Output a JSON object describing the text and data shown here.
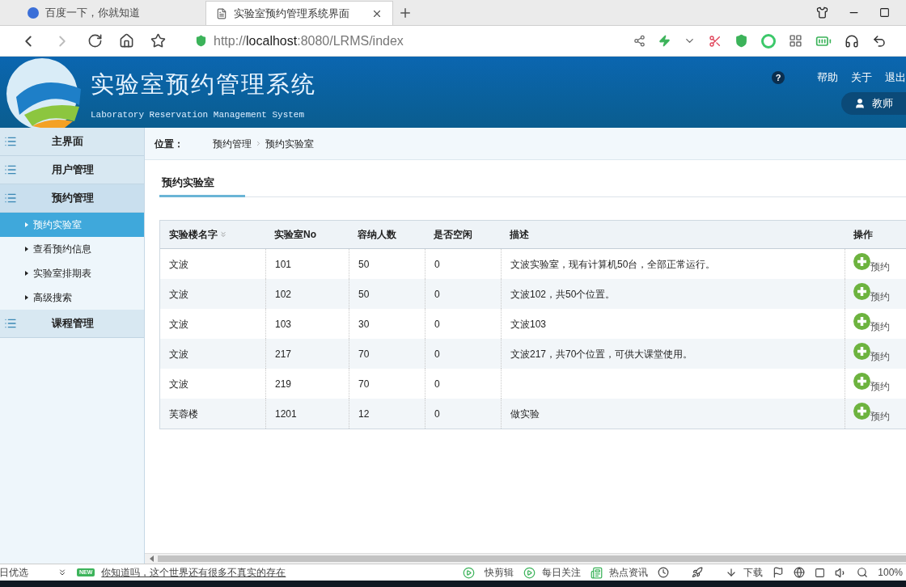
{
  "browser": {
    "tabs": [
      {
        "title": "百度一下，你就知道",
        "selected": false
      },
      {
        "title": "实验室预约管理系统界面",
        "selected": true
      }
    ],
    "url": "http://**localhost**:8080/LRMS/index"
  },
  "header": {
    "title": "实验室预约管理系统",
    "subtitle": "Laboratory Reservation Management System",
    "help_mark": "?",
    "links": [
      "帮助",
      "关于",
      "退出"
    ],
    "user": "教师"
  },
  "sidebar": {
    "items": [
      {
        "label": "主界面",
        "expanded": false
      },
      {
        "label": "用户管理",
        "expanded": false
      },
      {
        "label": "预约管理",
        "expanded": true,
        "children": [
          {
            "label": "预约实验室",
            "selected": true
          },
          {
            "label": "查看预约信息",
            "selected": false
          },
          {
            "label": "实验室排期表",
            "selected": false
          },
          {
            "label": "高级搜索",
            "selected": false
          }
        ]
      },
      {
        "label": "课程管理",
        "expanded": false
      }
    ]
  },
  "breadcrumb": {
    "label": "位置：",
    "path": [
      "预约管理",
      "预约实验室"
    ]
  },
  "panel_title": "预约实验室",
  "table": {
    "columns": [
      {
        "label": "实验楼名字",
        "sortable": true
      },
      {
        "label": "实验室No",
        "sortable": false
      },
      {
        "label": "容纳人数",
        "sortable": false
      },
      {
        "label": "是否空闲",
        "sortable": false
      },
      {
        "label": "描述",
        "sortable": false
      },
      {
        "label": "操作",
        "sortable": false
      }
    ],
    "rows": [
      {
        "cells": [
          "文波",
          "101",
          "50",
          "0",
          "文波实验室，现有计算机50台，全部正常运行。"
        ],
        "action": "预约"
      },
      {
        "cells": [
          "文波",
          "102",
          "50",
          "0",
          "文波102，共50个位置。"
        ],
        "action": "预约"
      },
      {
        "cells": [
          "文波",
          "103",
          "30",
          "0",
          "文波103"
        ],
        "action": "预约"
      },
      {
        "cells": [
          "文波",
          "217",
          "70",
          "0",
          "文波217，共70个位置，可供大课堂使用。"
        ],
        "action": "预约"
      },
      {
        "cells": [
          "文波",
          "219",
          "70",
          "0",
          ""
        ],
        "action": "预约"
      },
      {
        "cells": [
          "芙蓉楼",
          "1201",
          "12",
          "0",
          "做实验"
        ],
        "action": "预约"
      }
    ]
  },
  "status_bar": {
    "left": "日优选",
    "badge": "NEW",
    "news": "你知道吗，这个世界还有很多不真实的存在",
    "items": [
      "快剪辑",
      "每日关注",
      "热点资讯",
      "下载"
    ],
    "zoom": "100%"
  }
}
